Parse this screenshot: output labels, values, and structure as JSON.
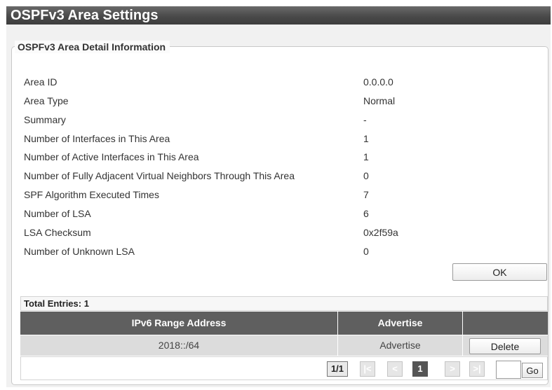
{
  "page": {
    "title": "OSPFv3 Area Settings"
  },
  "detail": {
    "legend": "OSPFv3 Area Detail Information",
    "rows": [
      {
        "label": "Area ID",
        "value": "0.0.0.0"
      },
      {
        "label": "Area Type",
        "value": "Normal"
      },
      {
        "label": "Summary",
        "value": "-"
      },
      {
        "label": "Number of Interfaces in This Area",
        "value": "1"
      },
      {
        "label": "Number of Active Interfaces in This Area",
        "value": "1"
      },
      {
        "label": "Number of Fully Adjacent Virtual Neighbors Through This Area",
        "value": "0"
      },
      {
        "label": "SPF Algorithm Executed Times",
        "value": "7"
      },
      {
        "label": "Number of LSA",
        "value": "6"
      },
      {
        "label": "LSA Checksum",
        "value": "0x2f59a"
      },
      {
        "label": "Number of Unknown LSA",
        "value": "0"
      }
    ],
    "ok_label": "OK"
  },
  "table": {
    "total_entries": "Total Entries: 1",
    "columns": [
      "IPv6 Range Address",
      "Advertise",
      ""
    ],
    "rows": [
      {
        "address": "2018::/64",
        "advertise": "Advertise",
        "action": "Delete"
      }
    ]
  },
  "pager": {
    "info": "1/1",
    "first": "|<",
    "prev": "<",
    "current": "1",
    "next": ">",
    "last": ">|",
    "page_input_value": "",
    "go_label": "Go"
  }
}
